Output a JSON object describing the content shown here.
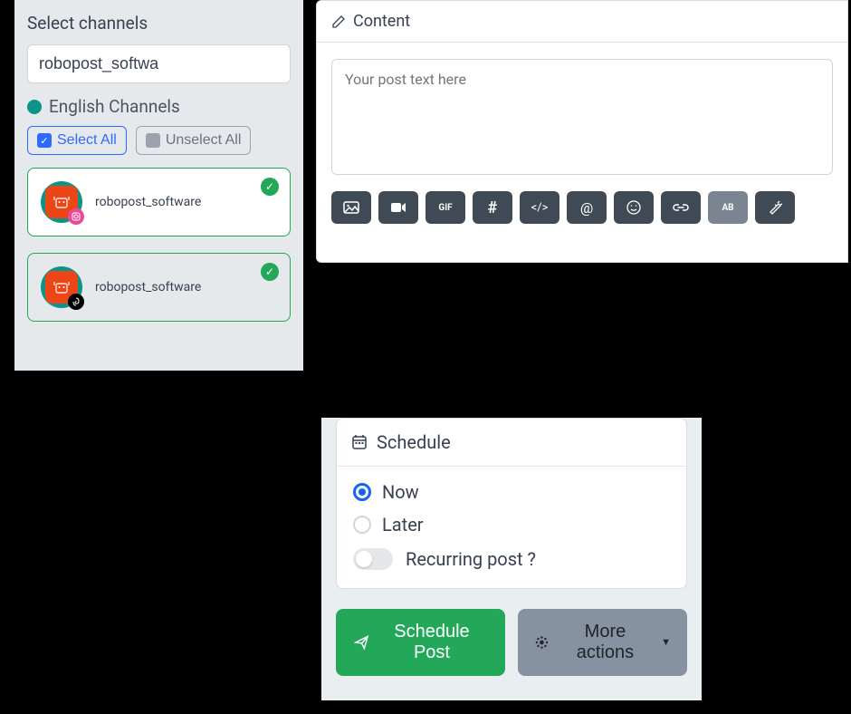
{
  "channels": {
    "title": "Select channels",
    "search_value": "robopost_softwa",
    "group_label": "English Channels",
    "select_all_label": "Select All",
    "unselect_all_label": "Unselect All",
    "items": [
      {
        "name": "robopost_software",
        "network": "instagram",
        "selected": true,
        "bg": "white"
      },
      {
        "name": "robopost_software",
        "network": "threads",
        "selected": true,
        "bg": "grey"
      }
    ]
  },
  "content": {
    "header": "Content",
    "placeholder": "Your post text here",
    "toolbar": [
      {
        "id": "image",
        "icon": "image-icon"
      },
      {
        "id": "video",
        "icon": "video-icon"
      },
      {
        "id": "gif",
        "icon": "gif-icon"
      },
      {
        "id": "hashtag",
        "icon": "hash-icon"
      },
      {
        "id": "code",
        "icon": "code-icon"
      },
      {
        "id": "mention",
        "icon": "at-icon"
      },
      {
        "id": "emoji",
        "icon": "smile-icon"
      },
      {
        "id": "link",
        "icon": "link-icon"
      },
      {
        "id": "case",
        "icon": "case-icon",
        "active": true
      },
      {
        "id": "magic",
        "icon": "magic-icon"
      }
    ]
  },
  "schedule": {
    "header": "Schedule",
    "options": {
      "now": "Now",
      "later": "Later"
    },
    "selected": "now",
    "recurring_label": "Recurring post ?",
    "submit_label": "Schedule Post",
    "more_label": "More actions"
  }
}
